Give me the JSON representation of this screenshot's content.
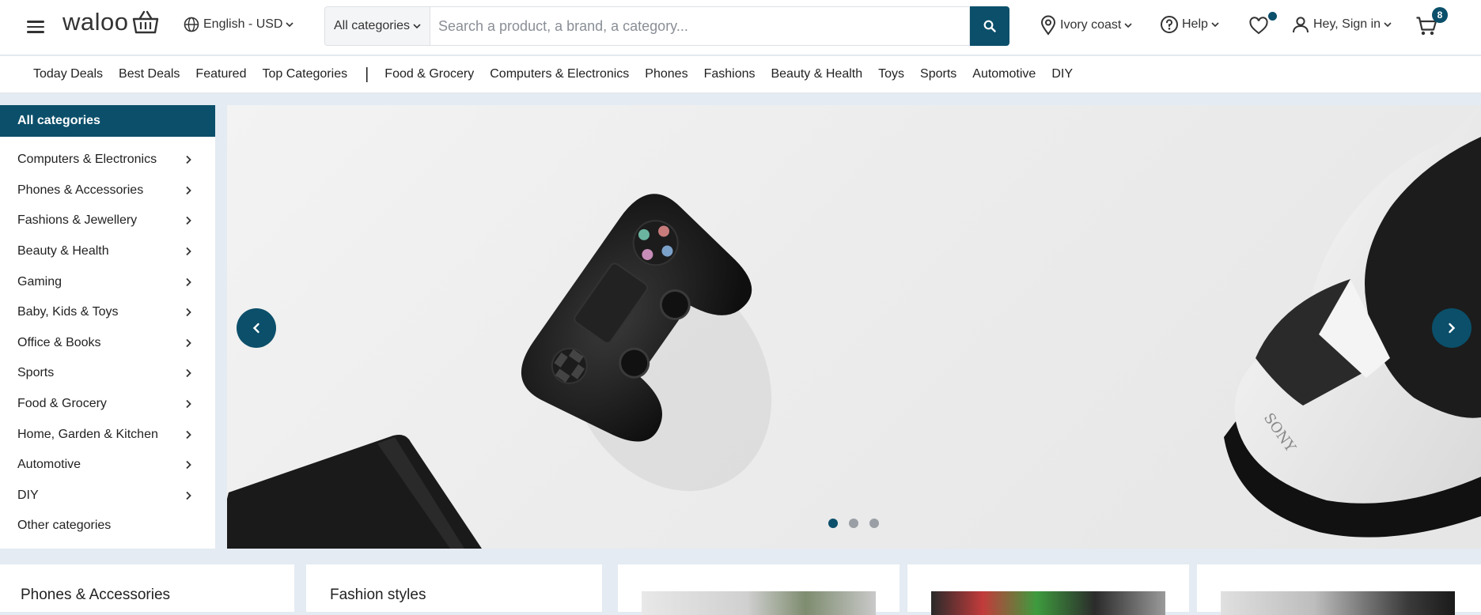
{
  "brand": {
    "name": "waloo"
  },
  "header": {
    "language": "English - USD",
    "search": {
      "category": "All categories",
      "placeholder": "Search a product, a brand, a category..."
    },
    "location": "Ivory coast",
    "help": "Help",
    "account": "Hey, Sign in",
    "cart_count": "8"
  },
  "navbar": {
    "primary": [
      "Today Deals",
      "Best Deals",
      "Featured",
      "Top Categories"
    ],
    "separator": "|",
    "categories": [
      "Food & Grocery",
      "Computers & Electronics",
      "Phones",
      "Fashions",
      "Beauty & Health",
      "Toys",
      "Sports",
      "Automotive",
      "DIY"
    ]
  },
  "sidebar": {
    "title": "All categories",
    "items": [
      {
        "label": "Computers & Electronics"
      },
      {
        "label": "Phones & Accessories"
      },
      {
        "label": "Fashions & Jewellery"
      },
      {
        "label": "Beauty & Health"
      },
      {
        "label": "Gaming"
      },
      {
        "label": "Baby, Kids & Toys"
      },
      {
        "label": "Office & Books"
      },
      {
        "label": "Sports"
      },
      {
        "label": "Food & Grocery"
      },
      {
        "label": "Home, Garden & Kitchen"
      },
      {
        "label": "Automotive"
      },
      {
        "label": "DIY"
      }
    ],
    "other": "Other categories"
  },
  "banner": {
    "slide_count": 3,
    "active_slide": 1,
    "brand_text": "SONY"
  },
  "cards": [
    {
      "title": "Phones & Accessories"
    },
    {
      "title": "Fashion styles"
    },
    {
      "title": ""
    },
    {
      "title": ""
    },
    {
      "title": ""
    }
  ],
  "colors": {
    "accent": "#0b4f6a",
    "page_bg": "#e4ebf2"
  },
  "icons": [
    "menu-icon",
    "basket-icon",
    "globe-icon",
    "search-icon",
    "location-pin-icon",
    "help-icon",
    "heart-icon",
    "user-icon",
    "cart-icon",
    "chevron-right-icon",
    "chevron-left-icon"
  ]
}
